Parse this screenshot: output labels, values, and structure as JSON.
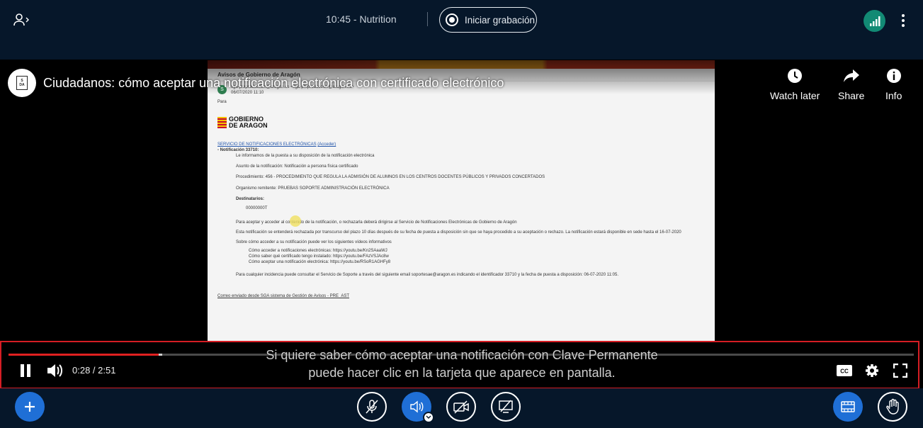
{
  "header": {
    "meeting_title": "10:45 - Nutrition",
    "record_label": "Iniciar grabación"
  },
  "video": {
    "title": "Ciudadanos: cómo aceptar una notificación electrónica con certificado electrónico",
    "actions": [
      {
        "label": "Watch later",
        "icon": "clock-icon"
      },
      {
        "label": "Share",
        "icon": "share-icon"
      },
      {
        "label": "Info",
        "icon": "info-icon"
      }
    ],
    "time": "0:28 / 2:51",
    "progress": 0.166,
    "buffered": 0.17,
    "caption_line1": "Si quiere saber cómo aceptar una notificación con Clave Permanente",
    "caption_line2": "puede hacer clic en la tarjeta que aparece en pantalla."
  },
  "frame_email": {
    "subject": "Avisos de Gobierno de Aragón",
    "sender_initial": "S",
    "sender": "sga-preproduccion@aragon.es <sga-preproduccion@aragon.es>",
    "date": "06/07/2020 11:10",
    "para": "Para",
    "logo_line1": "GOBIERNO",
    "logo_line2": "DE ARAGON",
    "service": "SERVICIO DE NOTIFICACIONES ELECTRÓNICAS",
    "acceder": "(Acceder)",
    "notif": "- Notificación 33710:",
    "intro": "Le informamos de la puesta a su disposición de la notificación electrónica",
    "asunto": "Asunto de la notificación: Notificación a persona física certificado",
    "procedimiento": "Procedimiento: 456 - PROCEDIMIENTO QUE REGULA LA ADMISIÓN DE ALUMNOS EN LOS CENTROS DOCENTES PÚBLICOS Y PRIVADOS CONCERTADOS",
    "organismo": "Organismo remitente: PRUEBAS SOPORTE ADMINISTRACIÓN ELECTRÓNICA",
    "destinatarios": "Destinatarios:",
    "dest_value": "00000000T",
    "aceptar": "Para aceptar y acceder al contenido de la notificación, o rechazarla deberá dirigirse al Servicio de Notificaciones Electrónicas de Gobierno de Aragón",
    "rechazada": "Esta notificación se entenderá rechazada por transcurso del plazo 10 días después de su fecha de puesta a disposición sin que se haya procedido a su aceptación o rechazo. La notificación estará disponible en sede hasta el 16-07-2020",
    "videos_intro": "Sobre cómo acceder a su notificación puede ver los siguientes vídeos informativos",
    "video1": "Cómo acceder a notificaciones electrónicas: https://youtu.be/Kn2SAaaWJ",
    "video2": "Cómo saber qué certificado tengo instalado: https://youtu.be/FAzVSJAc8w",
    "video3": "Cómo aceptar una notificación electrónica: https://youtu.be/RSoR1AGHFy8",
    "incidencia": "Para cualquier incidencia puede consultar el Servicio de Soporte a través del siguiente email soportesae@aragon.es indicando el identificador 33710 y la fecha de puesta a disposición: 06-07-2020 11:05.",
    "footer": "Correo enviado desde SGA sistema de Gestión de Avisos - PRE_AST"
  },
  "colors": {
    "background": "#06172a",
    "accent_blue": "#1f6fd6",
    "connection_green": "#128a74",
    "highlight_red": "#d51d24",
    "progress_red": "#e02020"
  }
}
